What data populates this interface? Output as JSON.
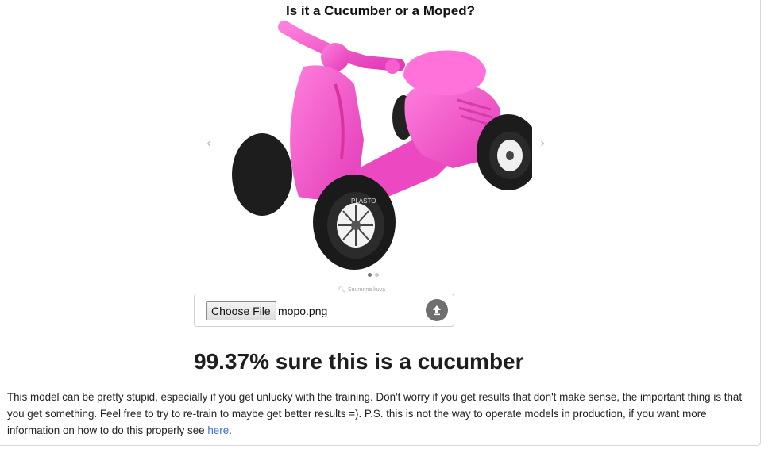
{
  "page": {
    "title": "Is it a Cucumber or a Moped?"
  },
  "carousel": {
    "prev_symbol": "‹",
    "next_symbol": "›",
    "dot_count": 2,
    "active_dot": 0,
    "caption": "Suurenna kuva",
    "image_brand_text": "PLASTO",
    "image_subject": "pink toy ride-on moped"
  },
  "upload": {
    "choose_label": "Choose File",
    "filename": "mopo.png",
    "upload_icon": "upload-arrow-icon"
  },
  "result": {
    "text": "99.37% sure this is a cucumber"
  },
  "note": {
    "text": "This model can be pretty stupid, especially if you get unlucky with the training. Don't worry if you get results that don't make sense, the important thing is that you get something. Feel free to try to re-train to maybe get better results =). P.S. this is not the way to operate models in production, if you want more information on how to do this properly see ",
    "link_text": "here",
    "end_text": "."
  },
  "colors": {
    "link": "#3b6fd1",
    "toy_pink": "#f24fc8",
    "wheel": "#1e1e1e"
  }
}
